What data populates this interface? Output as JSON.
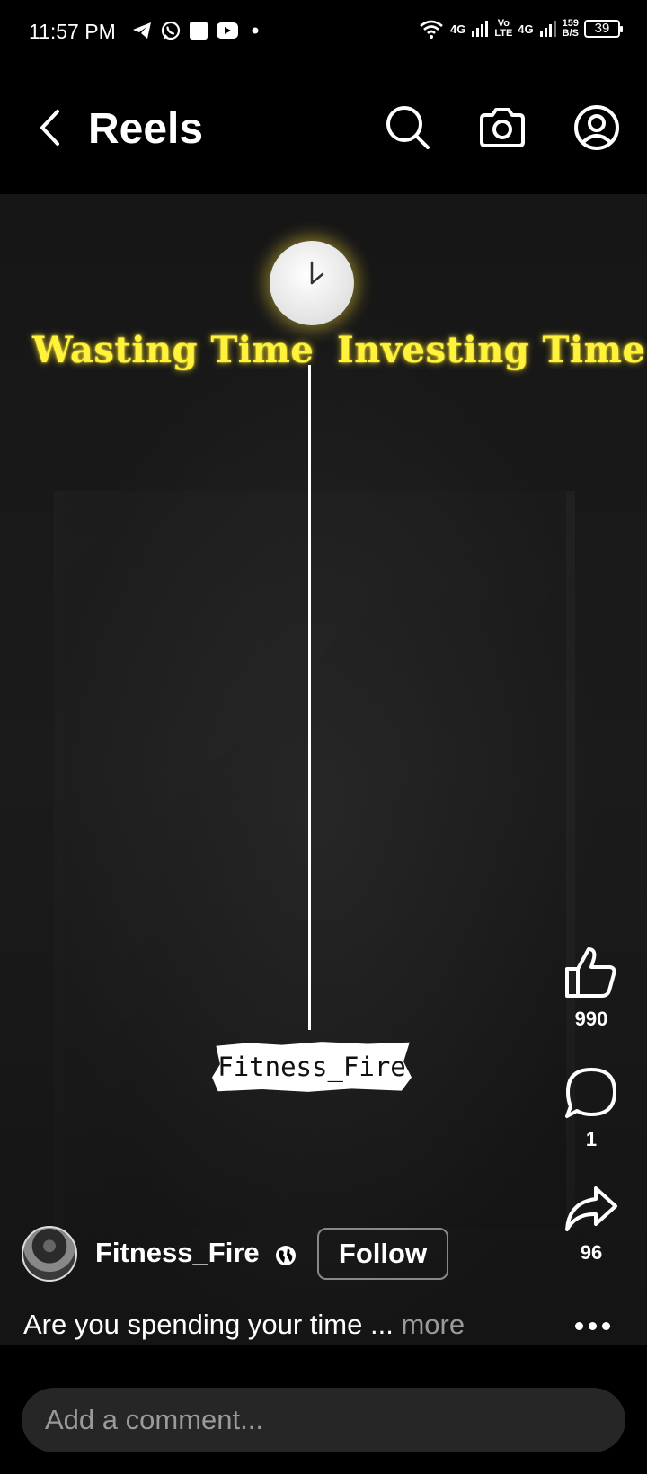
{
  "status_bar": {
    "time": "11:57 PM",
    "network1": "4G",
    "volte_top": "Vo",
    "volte_bottom": "LTE",
    "network2": "4G",
    "speed_value": "159",
    "speed_unit": "B/S",
    "battery": "39"
  },
  "header": {
    "title": "Reels",
    "icons": [
      "back-icon",
      "search-icon",
      "camera-icon",
      "profile-icon"
    ]
  },
  "video": {
    "left_caption": "Wasting Time",
    "right_caption": "Investing Time",
    "watermark": "Fitness_Fire",
    "caption_color": "#fff23a"
  },
  "actions": {
    "likes": "990",
    "comments": "1",
    "shares": "96"
  },
  "author": {
    "name": "Fitness_Fire",
    "follow_label": "Follow"
  },
  "description": {
    "text": "Are you spending your time ...",
    "more_label": "more"
  },
  "comment": {
    "placeholder": "Add a comment..."
  }
}
